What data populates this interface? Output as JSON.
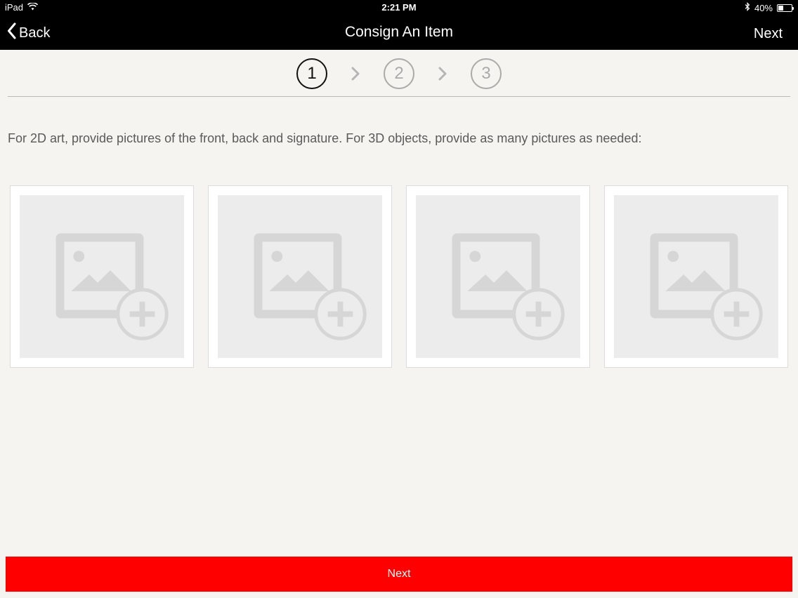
{
  "status_bar": {
    "device": "iPad",
    "time": "2:21 PM",
    "battery": "40%",
    "battery_level": 0.4
  },
  "nav": {
    "back_label": "Back",
    "title": "Consign An Item",
    "next_label": "Next"
  },
  "stepper": {
    "steps": [
      "1",
      "2",
      "3"
    ],
    "active_step": 1
  },
  "instruction": "For 2D art, provide pictures of the front, back and signature.  For 3D objects, provide as many pictures as needed:",
  "photo_slots": [
    {
      "icon": "add-photo-icon"
    },
    {
      "icon": "add-photo-icon"
    },
    {
      "icon": "add-photo-icon"
    },
    {
      "icon": "add-photo-icon"
    }
  ],
  "footer": {
    "next_label": "Next"
  },
  "colors": {
    "accent": "#ff0000",
    "background": "#f5f4f1",
    "topbar": "#000000"
  }
}
